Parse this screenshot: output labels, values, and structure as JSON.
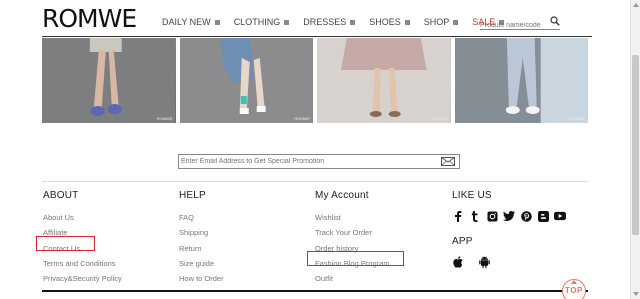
{
  "header": {
    "logo": "ROMWE",
    "nav": [
      {
        "label": "DAILY NEW"
      },
      {
        "label": "CLOTHING"
      },
      {
        "label": "DRESSES"
      },
      {
        "label": "SHOES"
      },
      {
        "label": "SHOP"
      },
      {
        "label": "SALE",
        "color": "#d0342c"
      }
    ],
    "search": {
      "placeholder": "Product name/code",
      "icon": "search-icon"
    }
  },
  "photos": [
    {
      "caption": "ROMWE"
    },
    {
      "caption": "ROMWE"
    },
    {
      "caption": "ROMWE"
    },
    {
      "caption": "ROMWE"
    }
  ],
  "newsletter": {
    "placeholder": "Enter Email Address to Get Special Promotion",
    "icon": "mail-icon"
  },
  "footer": {
    "about": {
      "title": "ABOUT",
      "links": [
        "About Us",
        "Affiliate",
        "Contact Us",
        "Terms and Conditions",
        "Privacy&Security Policy"
      ]
    },
    "help": {
      "title": "HELP",
      "links": [
        "FAQ",
        "Shipping",
        "Return",
        "Size guide",
        "How to Order"
      ]
    },
    "account": {
      "title": "My Account",
      "links": [
        "Wishlist",
        "Track Your Order",
        "Order history",
        "Fashion Blog Program",
        "Outfit"
      ]
    },
    "like": {
      "title": "LIKE US",
      "icons": [
        "facebook-icon",
        "tumblr-icon",
        "instagram-icon",
        "twitter-icon",
        "pinterest-icon",
        "blogger-icon",
        "youtube-icon"
      ]
    },
    "app": {
      "title": "APP",
      "icons": [
        "apple-icon",
        "android-icon"
      ]
    }
  },
  "highlight_color": "#d6282e",
  "top_button": {
    "label": "TOP"
  }
}
